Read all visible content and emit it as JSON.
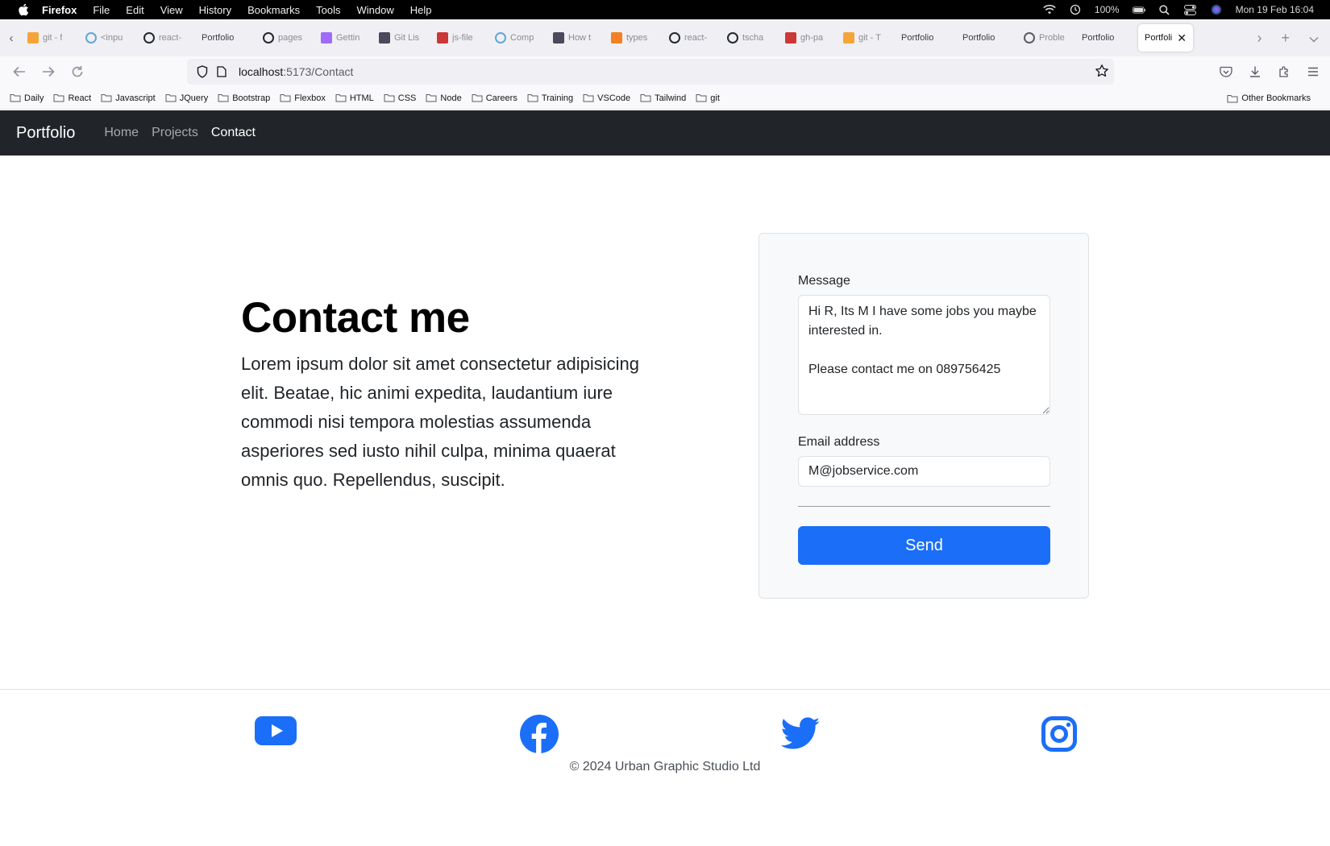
{
  "menubar": {
    "app_name": "Firefox",
    "items": [
      "File",
      "Edit",
      "View",
      "History",
      "Bookmarks",
      "Tools",
      "Window",
      "Help"
    ],
    "battery": "100%",
    "datetime": "Mon 19 Feb  16:04"
  },
  "tabs": [
    {
      "label": "git - f",
      "icon": "git-icon",
      "color": "#f4a53a"
    },
    {
      "label": "<inpu",
      "icon": "react-icon",
      "color": "#61a6d8"
    },
    {
      "label": "react-",
      "icon": "github-icon",
      "color": "#24292f"
    },
    {
      "label": "Portfolio",
      "icon": "",
      "color": ""
    },
    {
      "label": "pages",
      "icon": "github-icon",
      "color": "#24292f"
    },
    {
      "label": "Gettin",
      "icon": "vite-icon",
      "color": "#9f6bf8"
    },
    {
      "label": "Git Lis",
      "icon": "netlify-icon",
      "color": "#4a4a5a"
    },
    {
      "label": "js-file",
      "icon": "npm-icon",
      "color": "#cb3837"
    },
    {
      "label": "Comp",
      "icon": "react-icon",
      "color": "#61a6d8"
    },
    {
      "label": "How t",
      "icon": "netlify-icon",
      "color": "#4a4a5a"
    },
    {
      "label": "types",
      "icon": "stackoverflow-icon",
      "color": "#f48024"
    },
    {
      "label": "react-",
      "icon": "github-icon",
      "color": "#24292f"
    },
    {
      "label": "tscha",
      "icon": "github-icon",
      "color": "#24292f"
    },
    {
      "label": "gh-pa",
      "icon": "npm-icon",
      "color": "#cb3837"
    },
    {
      "label": "git - T",
      "icon": "git-icon",
      "color": "#f4a53a"
    },
    {
      "label": "Portfolio",
      "icon": "",
      "color": ""
    },
    {
      "label": "Portfolio",
      "icon": "",
      "color": ""
    },
    {
      "label": "Proble",
      "icon": "info-icon",
      "color": "#5b5b66"
    },
    {
      "label": "Portfolio",
      "icon": "",
      "color": ""
    }
  ],
  "active_tab": {
    "label": "Portfoli"
  },
  "url": {
    "host": "localhost",
    "path": ":5173/Contact"
  },
  "bookmarks": [
    "Daily",
    "React",
    "Javascript",
    "JQuery",
    "Bootstrap",
    "Flexbox",
    "HTML",
    "CSS",
    "Node",
    "Careers",
    "Training",
    "VSCode",
    "Tailwind",
    "git"
  ],
  "other_bookmarks": "Other Bookmarks",
  "navbar": {
    "brand": "Portfolio",
    "links": [
      {
        "label": "Home",
        "active": false
      },
      {
        "label": "Projects",
        "active": false
      },
      {
        "label": "Contact",
        "active": true
      }
    ]
  },
  "hero": {
    "title": "Contact me",
    "text": "Lorem ipsum dolor sit amet consectetur adipisicing elit. Beatae, hic animi expedita, laudantium iure commodi nisi tempora molestias assumenda asperiores sed iusto nihil culpa, minima quaerat omnis quo. Repellendus, suscipit."
  },
  "form": {
    "message_label": "Message",
    "message_value": "Hi R, Its M I have some jobs you maybe interested in.\n\nPlease contact me on 089756425",
    "email_label": "Email address",
    "email_value": "M@jobservice.com",
    "send_label": "Send"
  },
  "footer": {
    "social": [
      "youtube-icon",
      "facebook-icon",
      "twitter-icon",
      "instagram-icon"
    ],
    "copyright": "© 2024 Urban Graphic Studio Ltd"
  },
  "colors": {
    "navbar_bg": "#212529",
    "primary": "#1b6ef7",
    "card_bg": "#f8f9fa"
  }
}
